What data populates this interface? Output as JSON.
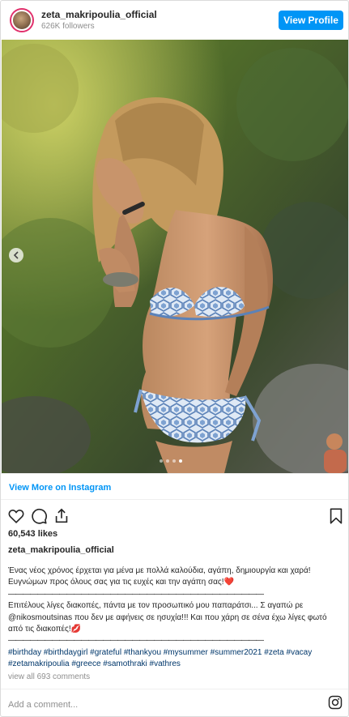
{
  "header": {
    "username": "zeta_makripoulia_official",
    "followers": "626K followers",
    "view_profile_label": "View Profile"
  },
  "post": {
    "image_alt": "zeta_makripoulia_official post photo",
    "carousel": {
      "slide_count": 4,
      "active_index": 3
    },
    "view_more_label": "View More on Instagram",
    "likes": "60,543 likes",
    "caption_username": "zeta_makripoulia_official",
    "caption": {
      "paragraph1": "Ένας νέος χρόνος έρχεται για μένα με πολλά καλούδια, αγάπη, δημιουργία και χαρά! Ευγνώμων προς όλους σας για τις ευχές και την αγάπη σας!❤️",
      "rule": "———————————————————————————————————",
      "paragraph2": "Επιτέλους λίγες διακοπές, πάντα με τον προσωπικό μου παπαράτσι... Σ αγαπώ ρε @nikosmoutsinas που δεν με αφήνεις σε ησυχία!!! Και που χάρη σε σένα έχω λίγες φωτό από τις διακοπές!💋",
      "hashtags": "#birthday #birthdaygirl #grateful #thankyou #mysummer #summer2021 #zeta #vacay #zetamakripoulia #greece #samothraki #vathres"
    },
    "view_all_comments": "view all 693 comments",
    "comment_placeholder": "Add a comment..."
  },
  "icons": {
    "like": "heart-icon",
    "comment": "comment-icon",
    "share": "share-icon",
    "save": "bookmark-icon",
    "instagram": "instagram-icon",
    "prev": "chevron-left-icon"
  },
  "colors": {
    "accent": "#0095f6",
    "text": "#262626",
    "muted": "#8e8e8e",
    "hashtag": "#00376b"
  }
}
